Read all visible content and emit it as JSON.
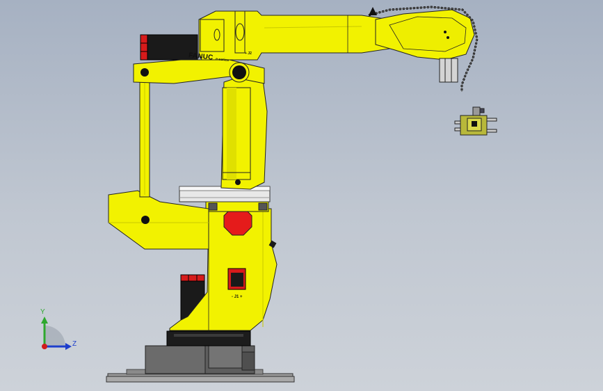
{
  "model": {
    "brand": "FANUC",
    "brand_suffix": "e-series",
    "joint_label_j1": "- J1 +",
    "joint_label_j2": "+ J2",
    "colors": {
      "robot_body": "#f2f200",
      "robot_shadow": "#c9c900",
      "stop_sign": "#e51b1b",
      "motor_black": "#1a1a1a",
      "motor_red": "#d61b1b",
      "base_gray": "#5e5e5e",
      "plate_gray": "#9c9c9c"
    }
  },
  "triad": {
    "y_label": "Y",
    "z_label": "Z",
    "y_color": "#2ea82e",
    "z_color": "#1e3ecc",
    "x_color": "#d01c1c"
  }
}
